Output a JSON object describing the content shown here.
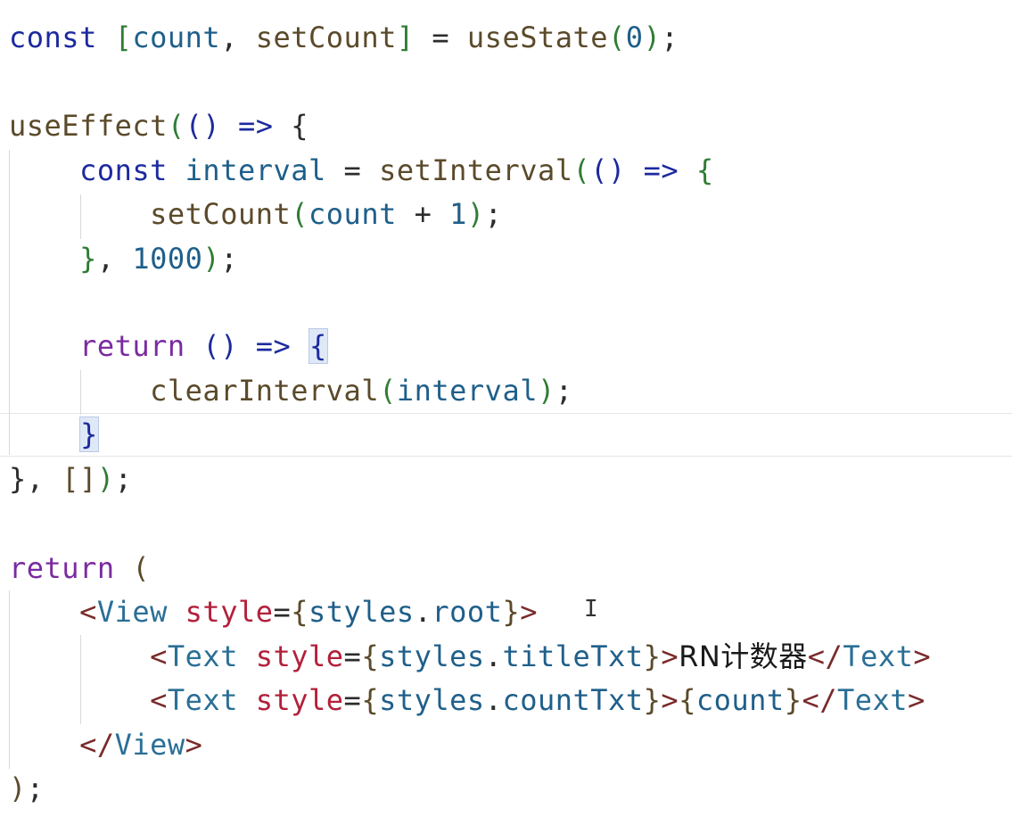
{
  "editor": {
    "lines": [
      "const [count, setCount] = useState(0);",
      "",
      "useEffect(() => {",
      "    const interval = setInterval(() => {",
      "        setCount(count + 1);",
      "    }, 1000);",
      "",
      "    return () => {",
      "        clearInterval(interval);",
      "    }",
      "}, []);",
      "",
      "return (",
      "    <View style={styles.root}>",
      "        <Text style={styles.titleTxt}>RN计数器</Text>",
      "        <Text style={styles.countTxt}>{count}</Text>",
      "    </View>",
      ");"
    ],
    "cursor_icon": "text-cursor-icon"
  }
}
